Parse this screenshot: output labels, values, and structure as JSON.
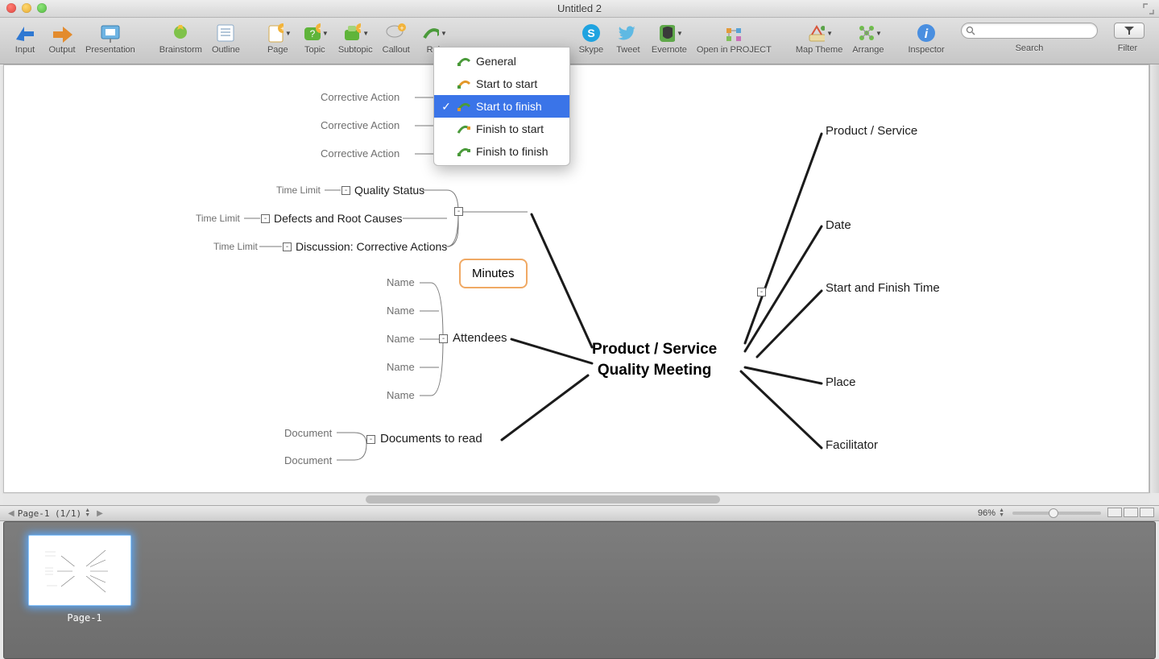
{
  "window": {
    "title": "Untitled 2"
  },
  "toolbar": {
    "input": "Input",
    "output": "Output",
    "presentation": "Presentation",
    "brainstorm": "Brainstorm",
    "outline": "Outline",
    "page": "Page",
    "topic": "Topic",
    "subtopic": "Subtopic",
    "callout": "Callout",
    "relation": "Rel",
    "skype": "Skype",
    "tweet": "Tweet",
    "evernote": "Evernote",
    "openinproject": "Open in PROJECT",
    "maptheme": "Map Theme",
    "arrange": "Arrange",
    "inspector": "Inspector",
    "search": "Search",
    "search_placeholder": "",
    "filter": "Filter"
  },
  "dropdown": {
    "items": [
      {
        "label": "General",
        "selected": false
      },
      {
        "label": "Start to start",
        "selected": false
      },
      {
        "label": "Start to finish",
        "selected": true
      },
      {
        "label": "Finish to start",
        "selected": false
      },
      {
        "label": "Finish to finish",
        "selected": false
      }
    ]
  },
  "map": {
    "center_line1": "Product / Service",
    "center_line2": "Quality Meeting",
    "minutes": "Minutes",
    "attendees": "Attendees",
    "documents": "Documents to read",
    "ca1": "Corrective Action",
    "ca2": "Corrective Action",
    "ca3": "Corrective Action",
    "qs": "Quality Status",
    "drc": "Defects and Root Causes",
    "dca": "Discussion: Corrective Actions",
    "tl1": "Time Limit",
    "tl2": "Time Limit",
    "tl3": "Time Limit",
    "n1": "Name",
    "n2": "Name",
    "n3": "Name",
    "n4": "Name",
    "n5": "Name",
    "doc1": "Document",
    "doc2": "Document",
    "r_product": "Product / Service",
    "r_date": "Date",
    "r_time": "Start and Finish Time",
    "r_place": "Place",
    "r_fac": "Facilitator"
  },
  "pagebar": {
    "page_label": "Page-1 (1/1)",
    "zoom": "96%"
  },
  "thumbs": {
    "p1": "Page-1"
  }
}
